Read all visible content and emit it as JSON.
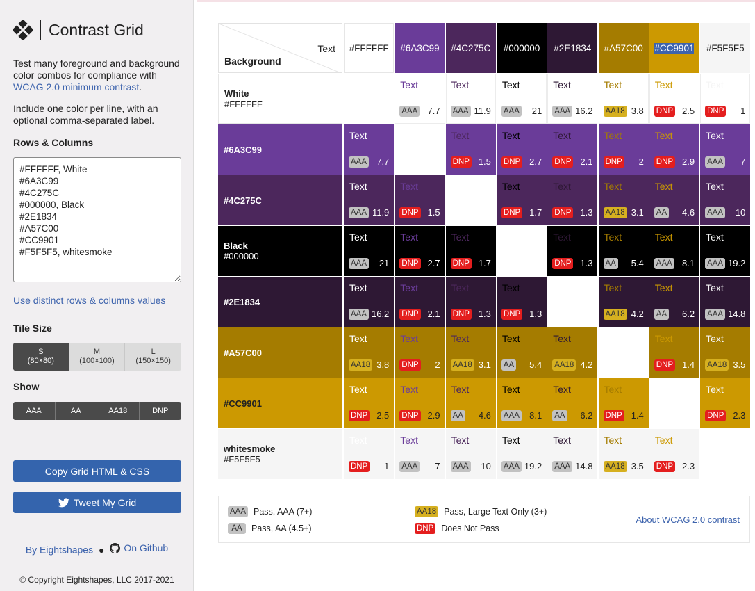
{
  "app": {
    "title": "Contrast Grid",
    "logo_icon": "eightshapes-diamond-icon"
  },
  "sidebar": {
    "intro_text": "Test many foreground and background color combos for compliance with",
    "intro_link": "WCAG 2.0 minimum contrast",
    "intro_end": ".",
    "instructions": "Include one color per line, with an optional comma-separated label.",
    "rows_heading": "Rows & Columns",
    "rows_value": "#FFFFFF, White\n#6A3C99\n#4C275C\n#000000, Black\n#2E1834\n#A57C00\n#CC9901\n#F5F5F5, whitesmoke",
    "distinct_link": "Use distinct rows & columns values",
    "tile_size_heading": "Tile Size",
    "tile_sizes": [
      {
        "label": "S",
        "sub": "(80×80)",
        "selected": true
      },
      {
        "label": "M",
        "sub": "(100×100)",
        "selected": false
      },
      {
        "label": "L",
        "sub": "(150×150)",
        "selected": false
      }
    ],
    "show_heading": "Show",
    "show_options": [
      "AAA",
      "AA",
      "AA18",
      "DNP"
    ],
    "copy_button": "Copy Grid HTML & CSS",
    "tweet_button": "Tweet My Grid",
    "tweet_icon": "twitter-bird-icon",
    "by_link": "By Eightshapes",
    "github_link": "On Github",
    "github_icon": "github-icon",
    "copyright": "© Copyright Eightshapes, LLC 2017-2021"
  },
  "grid": {
    "corner_text": "Text",
    "corner_background": "Background",
    "tile_text": "Text",
    "columns": [
      {
        "label": "#FFFFFF",
        "color": "#FFFFFF",
        "selected": false
      },
      {
        "label": "#6A3C99",
        "color": "#6A3C99",
        "selected": false
      },
      {
        "label": "#4C275C",
        "color": "#4C275C",
        "selected": false
      },
      {
        "label": "#000000",
        "color": "#000000",
        "selected": false
      },
      {
        "label": "#2E1834",
        "color": "#2E1834",
        "selected": false
      },
      {
        "label": "#A57C00",
        "color": "#A57C00",
        "selected": false
      },
      {
        "label": "#CC9901",
        "color": "#CC9901",
        "selected": true
      },
      {
        "label": "#F5F5F5",
        "color": "#F5F5F5",
        "selected": false
      }
    ],
    "rows": [
      {
        "label": "White",
        "hex": "#FFFFFF",
        "color": "#FFFFFF",
        "cells": [
          null,
          {
            "b": "AAA",
            "r": "7.7"
          },
          {
            "b": "AAA",
            "r": "11.9"
          },
          {
            "b": "AAA",
            "r": "21"
          },
          {
            "b": "AAA",
            "r": "16.2"
          },
          {
            "b": "AA18",
            "r": "3.8"
          },
          {
            "b": "DNP",
            "r": "2.5"
          },
          {
            "b": "DNP",
            "r": "1"
          }
        ]
      },
      {
        "label": "#6A3C99",
        "hex": "",
        "color": "#6A3C99",
        "cells": [
          {
            "b": "AAA",
            "r": "7.7"
          },
          null,
          {
            "b": "DNP",
            "r": "1.5"
          },
          {
            "b": "DNP",
            "r": "2.7"
          },
          {
            "b": "DNP",
            "r": "2.1"
          },
          {
            "b": "DNP",
            "r": "2"
          },
          {
            "b": "DNP",
            "r": "2.9"
          },
          {
            "b": "AAA",
            "r": "7"
          }
        ]
      },
      {
        "label": "#4C275C",
        "hex": "",
        "color": "#4C275C",
        "cells": [
          {
            "b": "AAA",
            "r": "11.9"
          },
          {
            "b": "DNP",
            "r": "1.5"
          },
          null,
          {
            "b": "DNP",
            "r": "1.7"
          },
          {
            "b": "DNP",
            "r": "1.3"
          },
          {
            "b": "AA18",
            "r": "3.1"
          },
          {
            "b": "AA",
            "r": "4.6"
          },
          {
            "b": "AAA",
            "r": "10"
          }
        ]
      },
      {
        "label": "Black",
        "hex": "#000000",
        "color": "#000000",
        "cells": [
          {
            "b": "AAA",
            "r": "21"
          },
          {
            "b": "DNP",
            "r": "2.7"
          },
          {
            "b": "DNP",
            "r": "1.7"
          },
          null,
          {
            "b": "DNP",
            "r": "1.3"
          },
          {
            "b": "AA",
            "r": "5.4"
          },
          {
            "b": "AAA",
            "r": "8.1"
          },
          {
            "b": "AAA",
            "r": "19.2"
          }
        ]
      },
      {
        "label": "#2E1834",
        "hex": "",
        "color": "#2E1834",
        "cells": [
          {
            "b": "AAA",
            "r": "16.2"
          },
          {
            "b": "DNP",
            "r": "2.1"
          },
          {
            "b": "DNP",
            "r": "1.3"
          },
          {
            "b": "DNP",
            "r": "1.3"
          },
          null,
          {
            "b": "AA18",
            "r": "4.2"
          },
          {
            "b": "AA",
            "r": "6.2"
          },
          {
            "b": "AAA",
            "r": "14.8"
          }
        ]
      },
      {
        "label": "#A57C00",
        "hex": "",
        "color": "#A57C00",
        "cells": [
          {
            "b": "AA18",
            "r": "3.8"
          },
          {
            "b": "DNP",
            "r": "2"
          },
          {
            "b": "AA18",
            "r": "3.1"
          },
          {
            "b": "AA",
            "r": "5.4"
          },
          {
            "b": "AA18",
            "r": "4.2"
          },
          null,
          {
            "b": "DNP",
            "r": "1.4"
          },
          {
            "b": "AA18",
            "r": "3.5"
          }
        ]
      },
      {
        "label": "#CC9901",
        "hex": "",
        "color": "#CC9901",
        "cells": [
          {
            "b": "DNP",
            "r": "2.5"
          },
          {
            "b": "DNP",
            "r": "2.9"
          },
          {
            "b": "AA",
            "r": "4.6"
          },
          {
            "b": "AAA",
            "r": "8.1"
          },
          {
            "b": "AA",
            "r": "6.2"
          },
          {
            "b": "DNP",
            "r": "1.4"
          },
          null,
          {
            "b": "DNP",
            "r": "2.3"
          }
        ]
      },
      {
        "label": "whitesmoke",
        "hex": "#F5F5F5",
        "color": "#F5F5F5",
        "cells": [
          {
            "b": "DNP",
            "r": "1"
          },
          {
            "b": "AAA",
            "r": "7"
          },
          {
            "b": "AAA",
            "r": "10"
          },
          {
            "b": "AAA",
            "r": "19.2"
          },
          {
            "b": "AAA",
            "r": "14.8"
          },
          {
            "b": "AA18",
            "r": "3.5"
          },
          {
            "b": "DNP",
            "r": "2.3"
          },
          null
        ]
      }
    ]
  },
  "legend": {
    "items": [
      {
        "badge": "AAA",
        "text": "Pass, AAA (7+)"
      },
      {
        "badge": "AA",
        "text": "Pass, AA (4.5+)"
      },
      {
        "badge": "AA18",
        "text": "Pass, Large Text Only (3+)"
      },
      {
        "badge": "DNP",
        "text": "Does Not Pass"
      }
    ],
    "about_link": "About WCAG 2.0 contrast"
  },
  "colors": {
    "link": "#3d63ad",
    "button": "#3464ad",
    "badge_aaa": "#c2c2c2",
    "badge_aa18": "#d6b020",
    "badge_dnp": "#e41e1e",
    "selection": "#3d63ad"
  }
}
